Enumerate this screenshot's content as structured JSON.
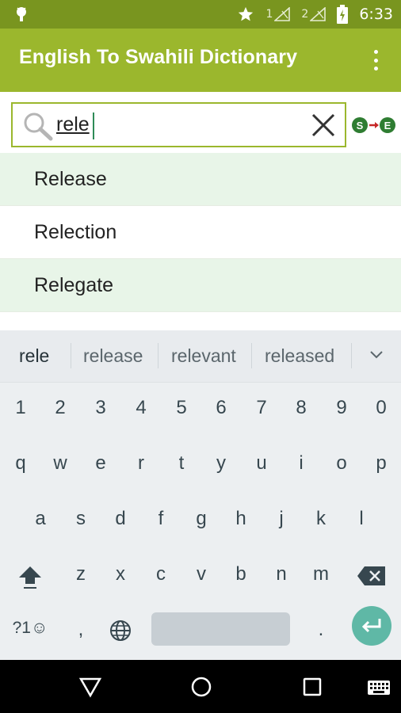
{
  "status_bar": {
    "sim1": "1",
    "sim2": "2",
    "time": "6:33",
    "icons": [
      "android-icon",
      "star-icon",
      "signal-icon",
      "battery-icon"
    ]
  },
  "app_bar": {
    "title": "English To Swahili Dictionary",
    "menu_icon": "more-vert-icon"
  },
  "search": {
    "value": "rele",
    "icon": "search-icon",
    "clear_icon": "close-icon",
    "language_toggle": {
      "from": "S",
      "to": "E"
    }
  },
  "results": [
    {
      "label": "Release"
    },
    {
      "label": "Relection"
    },
    {
      "label": "Relegate"
    }
  ],
  "keyboard": {
    "suggestions": [
      "rele",
      "release",
      "relevant",
      "released"
    ],
    "number_row": [
      "1",
      "2",
      "3",
      "4",
      "5",
      "6",
      "7",
      "8",
      "9",
      "0"
    ],
    "row1": [
      "q",
      "w",
      "e",
      "r",
      "t",
      "y",
      "u",
      "i",
      "o",
      "p"
    ],
    "row2": [
      "a",
      "s",
      "d",
      "f",
      "g",
      "h",
      "j",
      "k",
      "l"
    ],
    "row3": [
      "z",
      "x",
      "c",
      "v",
      "b",
      "n",
      "m"
    ],
    "bottom": {
      "symbols": "?1☺",
      "comma": ",",
      "period": "."
    }
  },
  "colors": {
    "status_bar": "#79951f",
    "app_bar": "#9bb72d",
    "result_alt": "#e8f5e8",
    "enter_key": "#5fb8a6"
  }
}
